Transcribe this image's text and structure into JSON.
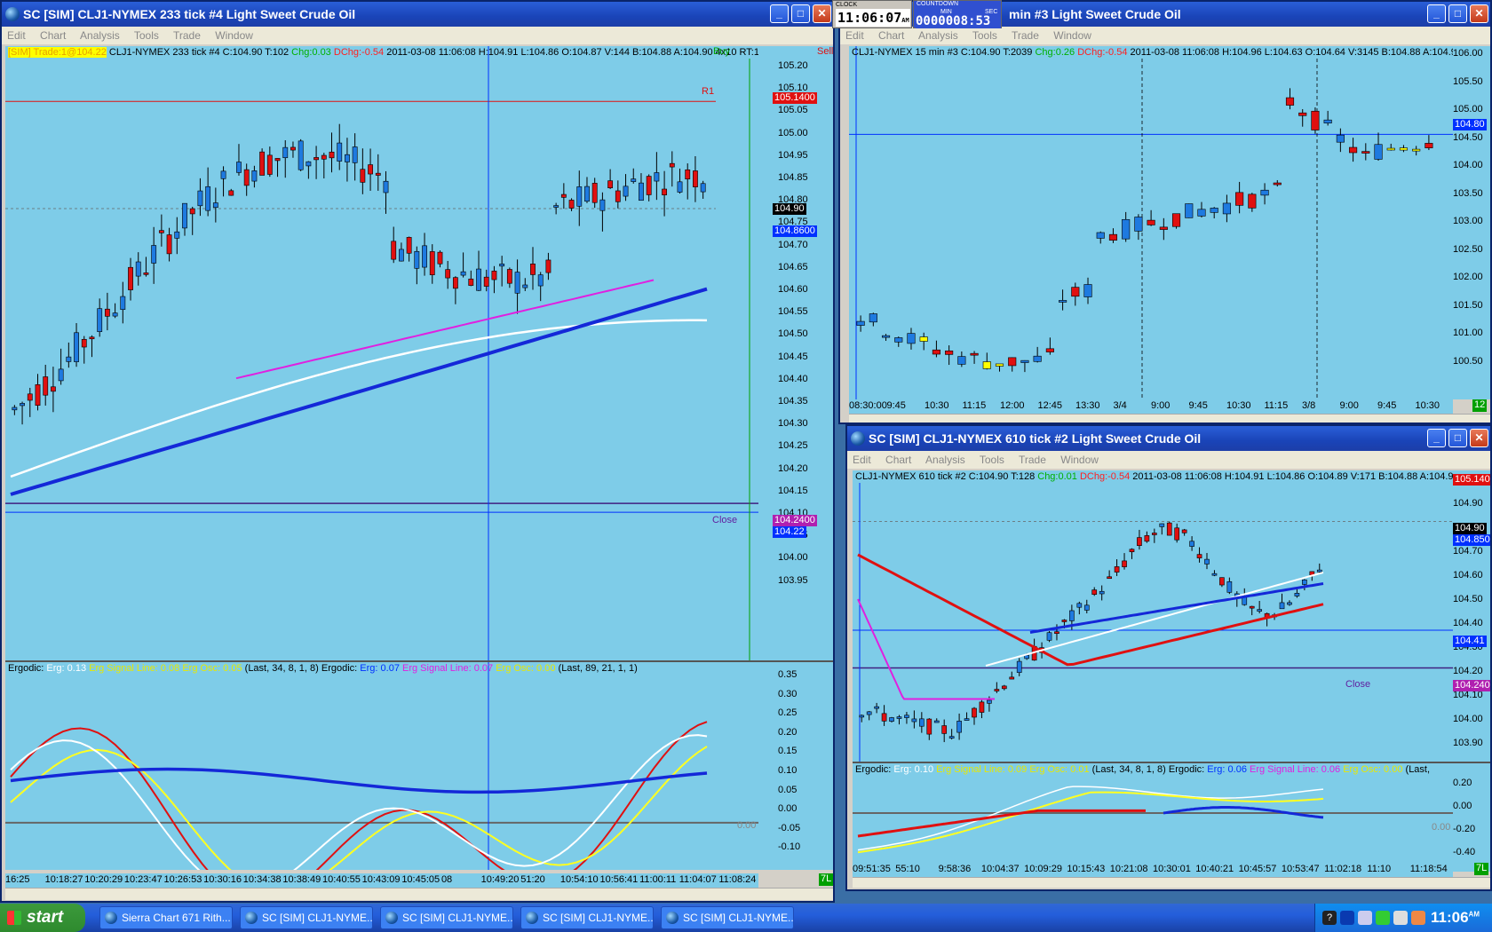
{
  "menu": [
    "Edit",
    "Chart",
    "Analysis",
    "Tools",
    "Trade",
    "Window"
  ],
  "win1": {
    "title": "SC [SIM] CLJ1-NYMEX  233 tick  #4  Light Sweet Crude Oil",
    "trade_badge": "[SIM]  Trade:1@104.22",
    "header": "CLJ1-NYMEX  233 tick  #4 C:104.90 T:102",
    "chg": "Chg:0.03",
    "dchg": "DChg:-0.54",
    "header2": "2011-03-08 11:06:08 H:104.91 L:104.86 O:104.87 V:144 B:104.88 A:104.90 4x10 RT:13",
    "buy": "Buy",
    "sell": "Sell",
    "yaxis": [
      "105.20",
      "105.10",
      "105.05",
      "105.00",
      "104.95",
      "104.85",
      "104.80",
      "104.75",
      "104.70",
      "104.65",
      "104.60",
      "104.55",
      "104.50",
      "104.45",
      "104.40",
      "104.35",
      "104.30",
      "104.25",
      "104.20",
      "104.15",
      "104.10",
      "104.05",
      "104.00",
      "103.95"
    ],
    "r1_label": "R1",
    "r1_price": "105.1400",
    "close_label": "Close",
    "close_price": "104.2400",
    "last_price": "104.90",
    "bid_price": "104.8600",
    "trade_price": "104.22",
    "ergodic1": {
      "name": "Ergodic:",
      "erg": "Erg: 0.13",
      "sig": "Erg Signal Line: 0.08",
      "osc": "Erg Osc: 0.05",
      "params": "(Last, 34, 8, 1, 8)"
    },
    "ergodic2": {
      "name": "Ergodic:",
      "erg": "Erg: 0.07",
      "sig": "Erg Signal Line: 0.07",
      "osc": "Erg Osc: 0.00",
      "params": "(Last, 89, 21, 1, 1)"
    },
    "osc_axis": [
      "0.35",
      "0.30",
      "0.25",
      "0.20",
      "0.15",
      "0.10",
      "0.05",
      "0.00",
      "-0.05",
      "-0.10"
    ],
    "osc_zero": "0.00",
    "xaxis": [
      "16:25",
      "10:18:27",
      "10:20:29",
      "10:23:47",
      "10:26:53",
      "10:30:16",
      "10:34:38",
      "10:38:49",
      "10:40:55",
      "10:43:09",
      "10:45:05",
      "08",
      "10:49:20",
      "51:20",
      "10:54:10",
      "10:56:41",
      "11:00:11",
      "11:04:07",
      "11:08:24"
    ],
    "corner": "7L"
  },
  "win2": {
    "title": "min   #3  Light Sweet Crude Oil",
    "header": "CLJ1-NYMEX  15 min  #3 C:104.90 T:2039",
    "chg": "Chg:0.26",
    "dchg": "DChg:-0.54",
    "header2": "2011-03-08 11:06:08 H:104.96 L:104.63 O:104.64 V:3145 B:104.88 A:104.90",
    "yaxis": [
      "106.00",
      "105.50",
      "105.00",
      "104.50",
      "104.00",
      "103.50",
      "103.00",
      "102.50",
      "102.00",
      "101.50",
      "101.00",
      "100.50"
    ],
    "last_price": "104.80",
    "xaxis": [
      "08:30:00",
      "9:45",
      "10:30",
      "11:15",
      "12:00",
      "12:45",
      "13:30",
      "3/4",
      "9:00",
      "9:45",
      "10:30",
      "11:15",
      "3/8",
      "9:00",
      "9:45",
      "10:30"
    ],
    "corner": "12"
  },
  "win3": {
    "title": "SC [SIM] CLJ1-NYMEX  610 tick  #2  Light Sweet Crude Oil",
    "header": "CLJ1-NYMEX  610 tick  #2 C:104.90 T:128",
    "chg": "Chg:0.01",
    "dchg": "DChg:-0.54",
    "header2": "2011-03-08 11:06:08 H:104.91 L:104.86 O:104.89 V:171 B:104.88 A:104.90",
    "yaxis": [
      "105.00",
      "104.90",
      "104.80",
      "104.70",
      "104.60",
      "104.50",
      "104.40",
      "104.30",
      "104.20",
      "104.10",
      "104.00",
      "103.90"
    ],
    "close_label": "Close",
    "close_price": "104.2400",
    "last_price": "104.90",
    "bid_price": "104.8500",
    "level_price": "104.41",
    "top_price": "105.1400",
    "ergodic1": {
      "name": "Ergodic:",
      "erg": "Erg: 0.10",
      "sig": "Erg Signal Line: 0.09",
      "osc": "Erg Osc: 0.01",
      "params": "(Last, 34, 8, 1, 8)"
    },
    "ergodic2": {
      "name": "Ergodic:",
      "erg": "Erg: 0.06",
      "sig": "Erg Signal Line: 0.06",
      "osc": "Erg Osc: 0.00",
      "params": "(Last,"
    },
    "osc_axis": [
      "0.20",
      "0.00",
      "-0.20",
      "-0.40"
    ],
    "osc_zero": "0.00",
    "xaxis": [
      "09:51:35",
      "55:10",
      "9:58:36",
      "10:04:37",
      "10:09:29",
      "10:15:43",
      "10:21:08",
      "10:30:01",
      "10:40:21",
      "10:45:57",
      "10:53:47",
      "11:02:18",
      "11:10",
      "11:18:54"
    ],
    "corner": "7L"
  },
  "clock": {
    "label": "CLOCK",
    "hh": "11",
    "mm": "06",
    "ss": "07",
    "ampm": "AM"
  },
  "countdown": {
    "label": "COUNTDOWN",
    "min": "MIN",
    "sec": "SEC",
    "value": "0000008",
    "secs": "53"
  },
  "taskbar": {
    "start": "start",
    "tasks": [
      "Sierra Chart 671 Rith...",
      "SC [SIM] CLJ1-NYME...",
      "SC [SIM] CLJ1-NYME...",
      "SC [SIM] CLJ1-NYME...",
      "SC [SIM] CLJ1-NYME..."
    ],
    "time": "11:06",
    "ampm": "AM"
  },
  "colors": {
    "chart_bg": "#7ecce8",
    "up": "#1e7ae0",
    "down": "#e01010",
    "doji": "#ffff00",
    "ma_white": "#ffffff",
    "ma_blue": "#1428d8",
    "ma_red": "#e01010",
    "magenta": "#e020e0"
  }
}
